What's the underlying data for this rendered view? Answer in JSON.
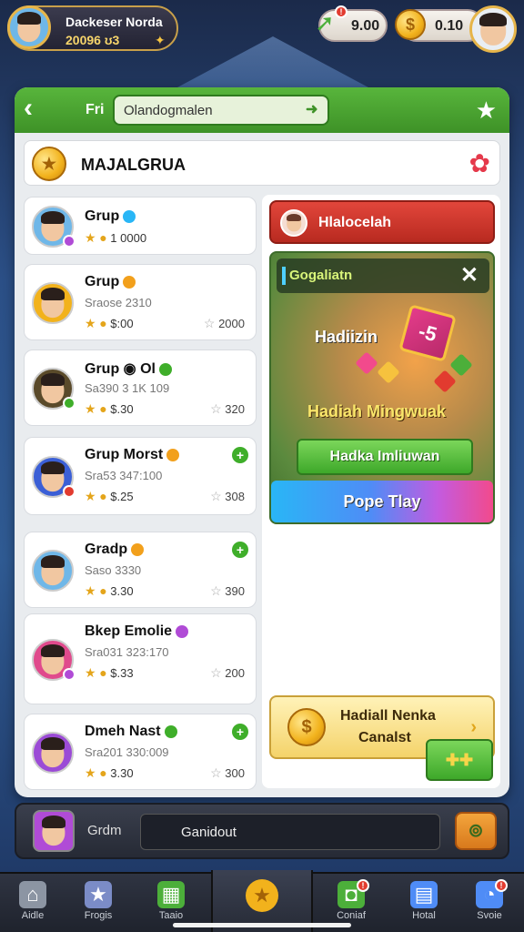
{
  "topbar": {
    "profile_name": "Dackeser Norda",
    "profile_sub": "20096 ʊ3",
    "gems_value": "9.00",
    "gems_badge": "!",
    "coins_value": "0.10"
  },
  "header": {
    "fi_label": "Fri",
    "search_value": "Olandogmalen"
  },
  "section": {
    "title": "MAJALGRUA"
  },
  "groups": [
    {
      "name": "Grup",
      "sub": "",
      "stats": "1 0000",
      "right": "",
      "status": "#29b6f6",
      "plus": false,
      "avatar_bg": "#6fb7e8",
      "badge": "#b04bd6"
    },
    {
      "name": "Grup",
      "sub": "Sraose 2310",
      "stats": "$:00",
      "right": "2000",
      "status": "#f2a01c",
      "plus": false,
      "avatar_bg": "#f2b21c",
      "badge": ""
    },
    {
      "name": "Grup ◉ Ol",
      "sub": "Sa390 3 1K 109",
      "stats": "$.30",
      "right": "320",
      "status": "#3fae2a",
      "plus": false,
      "avatar_bg": "#5a4a2a",
      "badge": "#3fae2a"
    },
    {
      "name": "Grup Morst",
      "sub": "Sra53 347:100",
      "stats": "$.25",
      "right": "308",
      "status": "#f2a01c",
      "plus": true,
      "avatar_bg": "#3b5fd6",
      "badge": "#e23b2f"
    },
    {
      "name": "Gradp",
      "sub": "Saso 3330",
      "stats": "3.30",
      "right": "390",
      "status": "#f2a01c",
      "plus": true,
      "avatar_bg": "#6fb7e8",
      "badge": ""
    },
    {
      "name": "Bkep Emolie",
      "sub": "Sra031 323:170",
      "stats": "$.33",
      "right": "200",
      "status": "#b04bd6",
      "plus": false,
      "avatar_bg": "#e04a8c",
      "badge": "#b04bd6"
    },
    {
      "name": "Dmeh Nast",
      "sub": "Sra201 330:009",
      "stats": "3.30",
      "right": "300",
      "status": "#3fae2a",
      "plus": true,
      "avatar_bg": "#9b4bd6",
      "badge": ""
    }
  ],
  "right": {
    "red_button": "Hlalocelah",
    "promo_head": "Gogaliatn",
    "promo_title1": "Hadiizin",
    "gift_label": "-5",
    "promo_title2": "Hadiah Mingwuak",
    "green_button": "Hadka Imliuwan",
    "rainbow_button": "Pope Tlay",
    "yellow_line1": "Hadiall Nenka",
    "yellow_line2": "Canalst",
    "small_button": "✚✚"
  },
  "chat": {
    "label": "Grdm",
    "input_value": "Ganidout"
  },
  "nav": [
    {
      "label": "Aidle",
      "icon": "home-icon",
      "glyph": "⌂",
      "color": "#8c95a3",
      "badge": ""
    },
    {
      "label": "Frogis",
      "icon": "star-icon",
      "glyph": "★",
      "color": "#7b8cc7",
      "badge": ""
    },
    {
      "label": "Taaio",
      "icon": "calendar-icon",
      "glyph": "▦",
      "color": "#4caf3a",
      "badge": ""
    },
    {
      "label": "",
      "icon": "coin-icon",
      "glyph": "★",
      "color": "#f2b21c",
      "badge": ""
    },
    {
      "label": "Coniaf",
      "icon": "robot-icon",
      "glyph": "◘",
      "color": "#4caf3a",
      "badge": "!"
    },
    {
      "label": "Hotal",
      "icon": "shop-icon",
      "glyph": "▤",
      "color": "#4f8cf6",
      "badge": ""
    },
    {
      "label": "Svoie",
      "icon": "chat-icon",
      "glyph": "◔",
      "color": "#4f8cf6",
      "badge": "!"
    }
  ]
}
